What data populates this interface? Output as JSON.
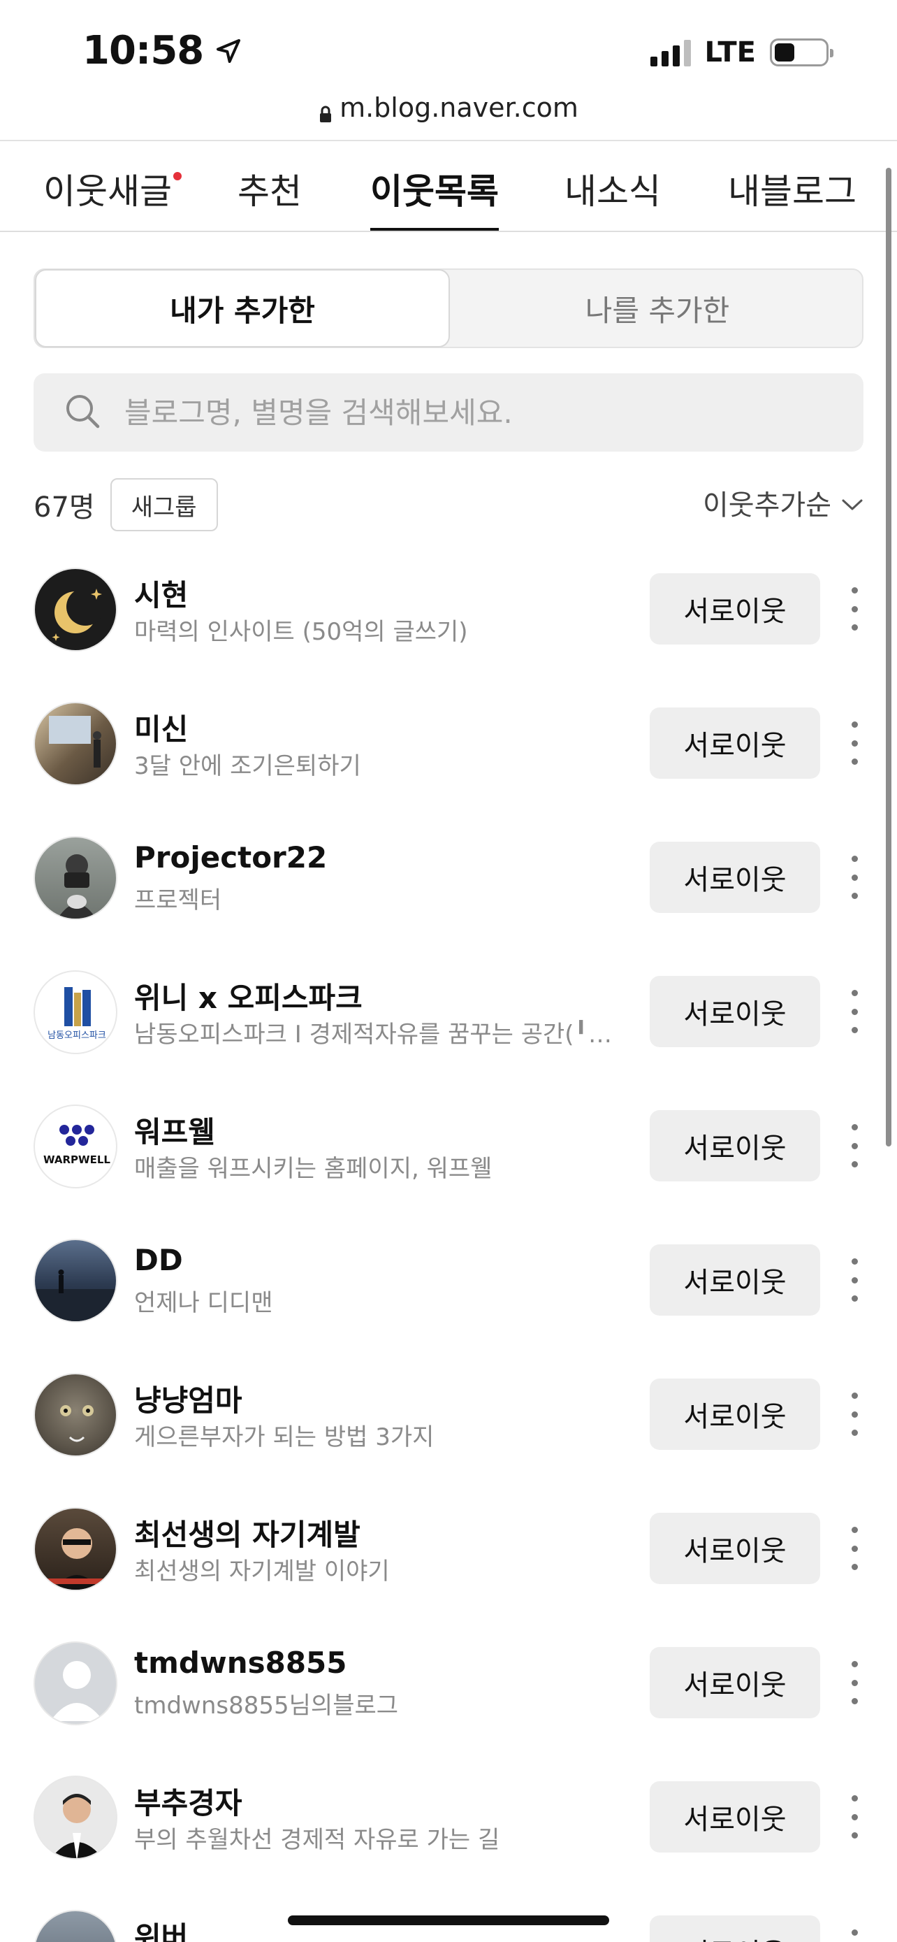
{
  "status_bar": {
    "time": "10:58",
    "network": "LTE",
    "battery_level": 0.4
  },
  "url": "m.blog.naver.com",
  "tabs": [
    {
      "label": "이웃새글",
      "has_new": true
    },
    {
      "label": "추천"
    },
    {
      "label": "이웃목록",
      "active": true
    },
    {
      "label": "내소식"
    },
    {
      "label": "내블로그"
    }
  ],
  "segments": {
    "added_by_me": "내가 추가한",
    "added_me": "나를 추가한"
  },
  "search": {
    "placeholder": "블로그명, 별명을 검색해보세요."
  },
  "count_row": {
    "count": "67명",
    "new_group": "새그룹",
    "sort": "이웃추가순"
  },
  "neighbors": [
    {
      "name": "시현",
      "desc": "마력의 인사이트 (50억의 글쓰기)",
      "button": "서로이웃"
    },
    {
      "name": "미신",
      "desc": "3달 안에 조기은퇴하기",
      "button": "서로이웃"
    },
    {
      "name": "Projector22",
      "desc": "프로젝터",
      "button": "서로이웃"
    },
    {
      "name": "위니 x 오피스파크",
      "desc": "남동오피스파크 I 경제적자유를 꿈꾸는 공간(╹◡…",
      "button": "서로이웃"
    },
    {
      "name": "워프웰",
      "desc": "매출을 워프시키는 홈페이지, 워프웰",
      "button": "서로이웃"
    },
    {
      "name": "DD",
      "desc": "언제나 디디맨",
      "button": "서로이웃"
    },
    {
      "name": "냥냥엄마",
      "desc": "게으른부자가 되는 방법 3가지",
      "button": "서로이웃"
    },
    {
      "name": "최선생의 자기계발",
      "desc": "최선생의 자기계발 이야기",
      "button": "서로이웃"
    },
    {
      "name": "tmdwns8855",
      "desc": "tmdwns8855님의블로그",
      "button": "서로이웃"
    },
    {
      "name": "부추경자",
      "desc": "부의 추월차선 경제적 자유로 가는 길",
      "button": "서로이웃"
    },
    {
      "name": "위버",
      "desc": "",
      "button": "서로이웃"
    }
  ],
  "avatar_labels": {
    "officepark": "남동오피스파크",
    "warpwell": "WARPWELL"
  }
}
